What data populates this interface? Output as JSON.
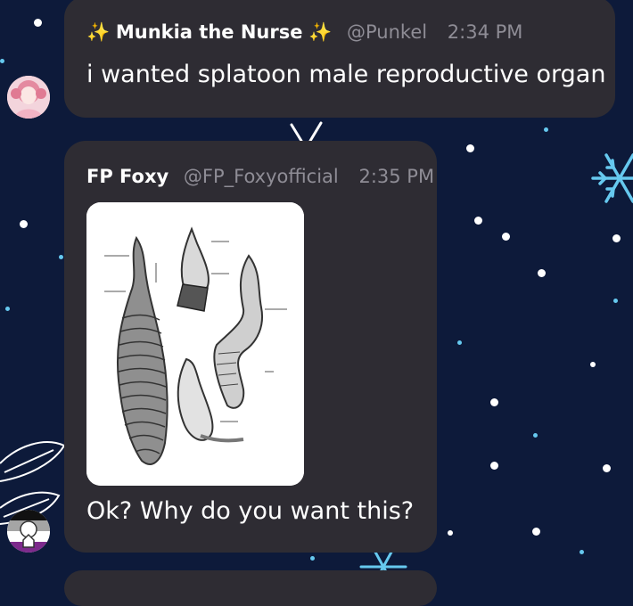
{
  "messages": [
    {
      "author": "Munkia the Nurse",
      "author_decoration": "✨",
      "handle": "@Punkel",
      "time": "2:34 PM",
      "text": "i wanted splatoon male reproductive organ"
    },
    {
      "author": "FP Foxy",
      "handle": "@FP_Foxyofficial",
      "time": "2:35 PM",
      "attachment": {
        "type": "image",
        "subject": "anatomical diagram drawing"
      },
      "text": "Ok? Why do you want this?"
    }
  ],
  "background": {
    "color": "#0d1a3a",
    "accent": "#66c9ef"
  },
  "colors": {
    "bubble": "#2e2c33",
    "meta": "#8f8d96"
  }
}
